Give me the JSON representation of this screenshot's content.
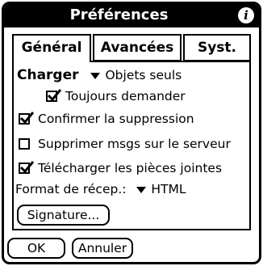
{
  "window": {
    "title": "Préférences",
    "info_icon": "info-icon"
  },
  "tabs": [
    {
      "label": "Général",
      "active": true
    },
    {
      "label": "Avancées",
      "active": false
    },
    {
      "label": "Syst.",
      "active": false
    }
  ],
  "general": {
    "charger_label": "Charger",
    "charger_value": "Objets seuls",
    "toujours_demander": {
      "label": "Toujours demander",
      "checked": true
    },
    "confirmer_suppression": {
      "label": "Confirmer la suppression",
      "checked": true
    },
    "supprimer_msgs": {
      "label": "Supprimer msgs sur le serveur",
      "checked": false
    },
    "telecharger_pieces": {
      "label": "Télécharger les pièces jointes",
      "checked": true
    },
    "format_label": "Format de récep.:",
    "format_value": "HTML",
    "signature_button": "Signature..."
  },
  "footer": {
    "ok_button": "OK",
    "cancel_button": "Annuler"
  }
}
